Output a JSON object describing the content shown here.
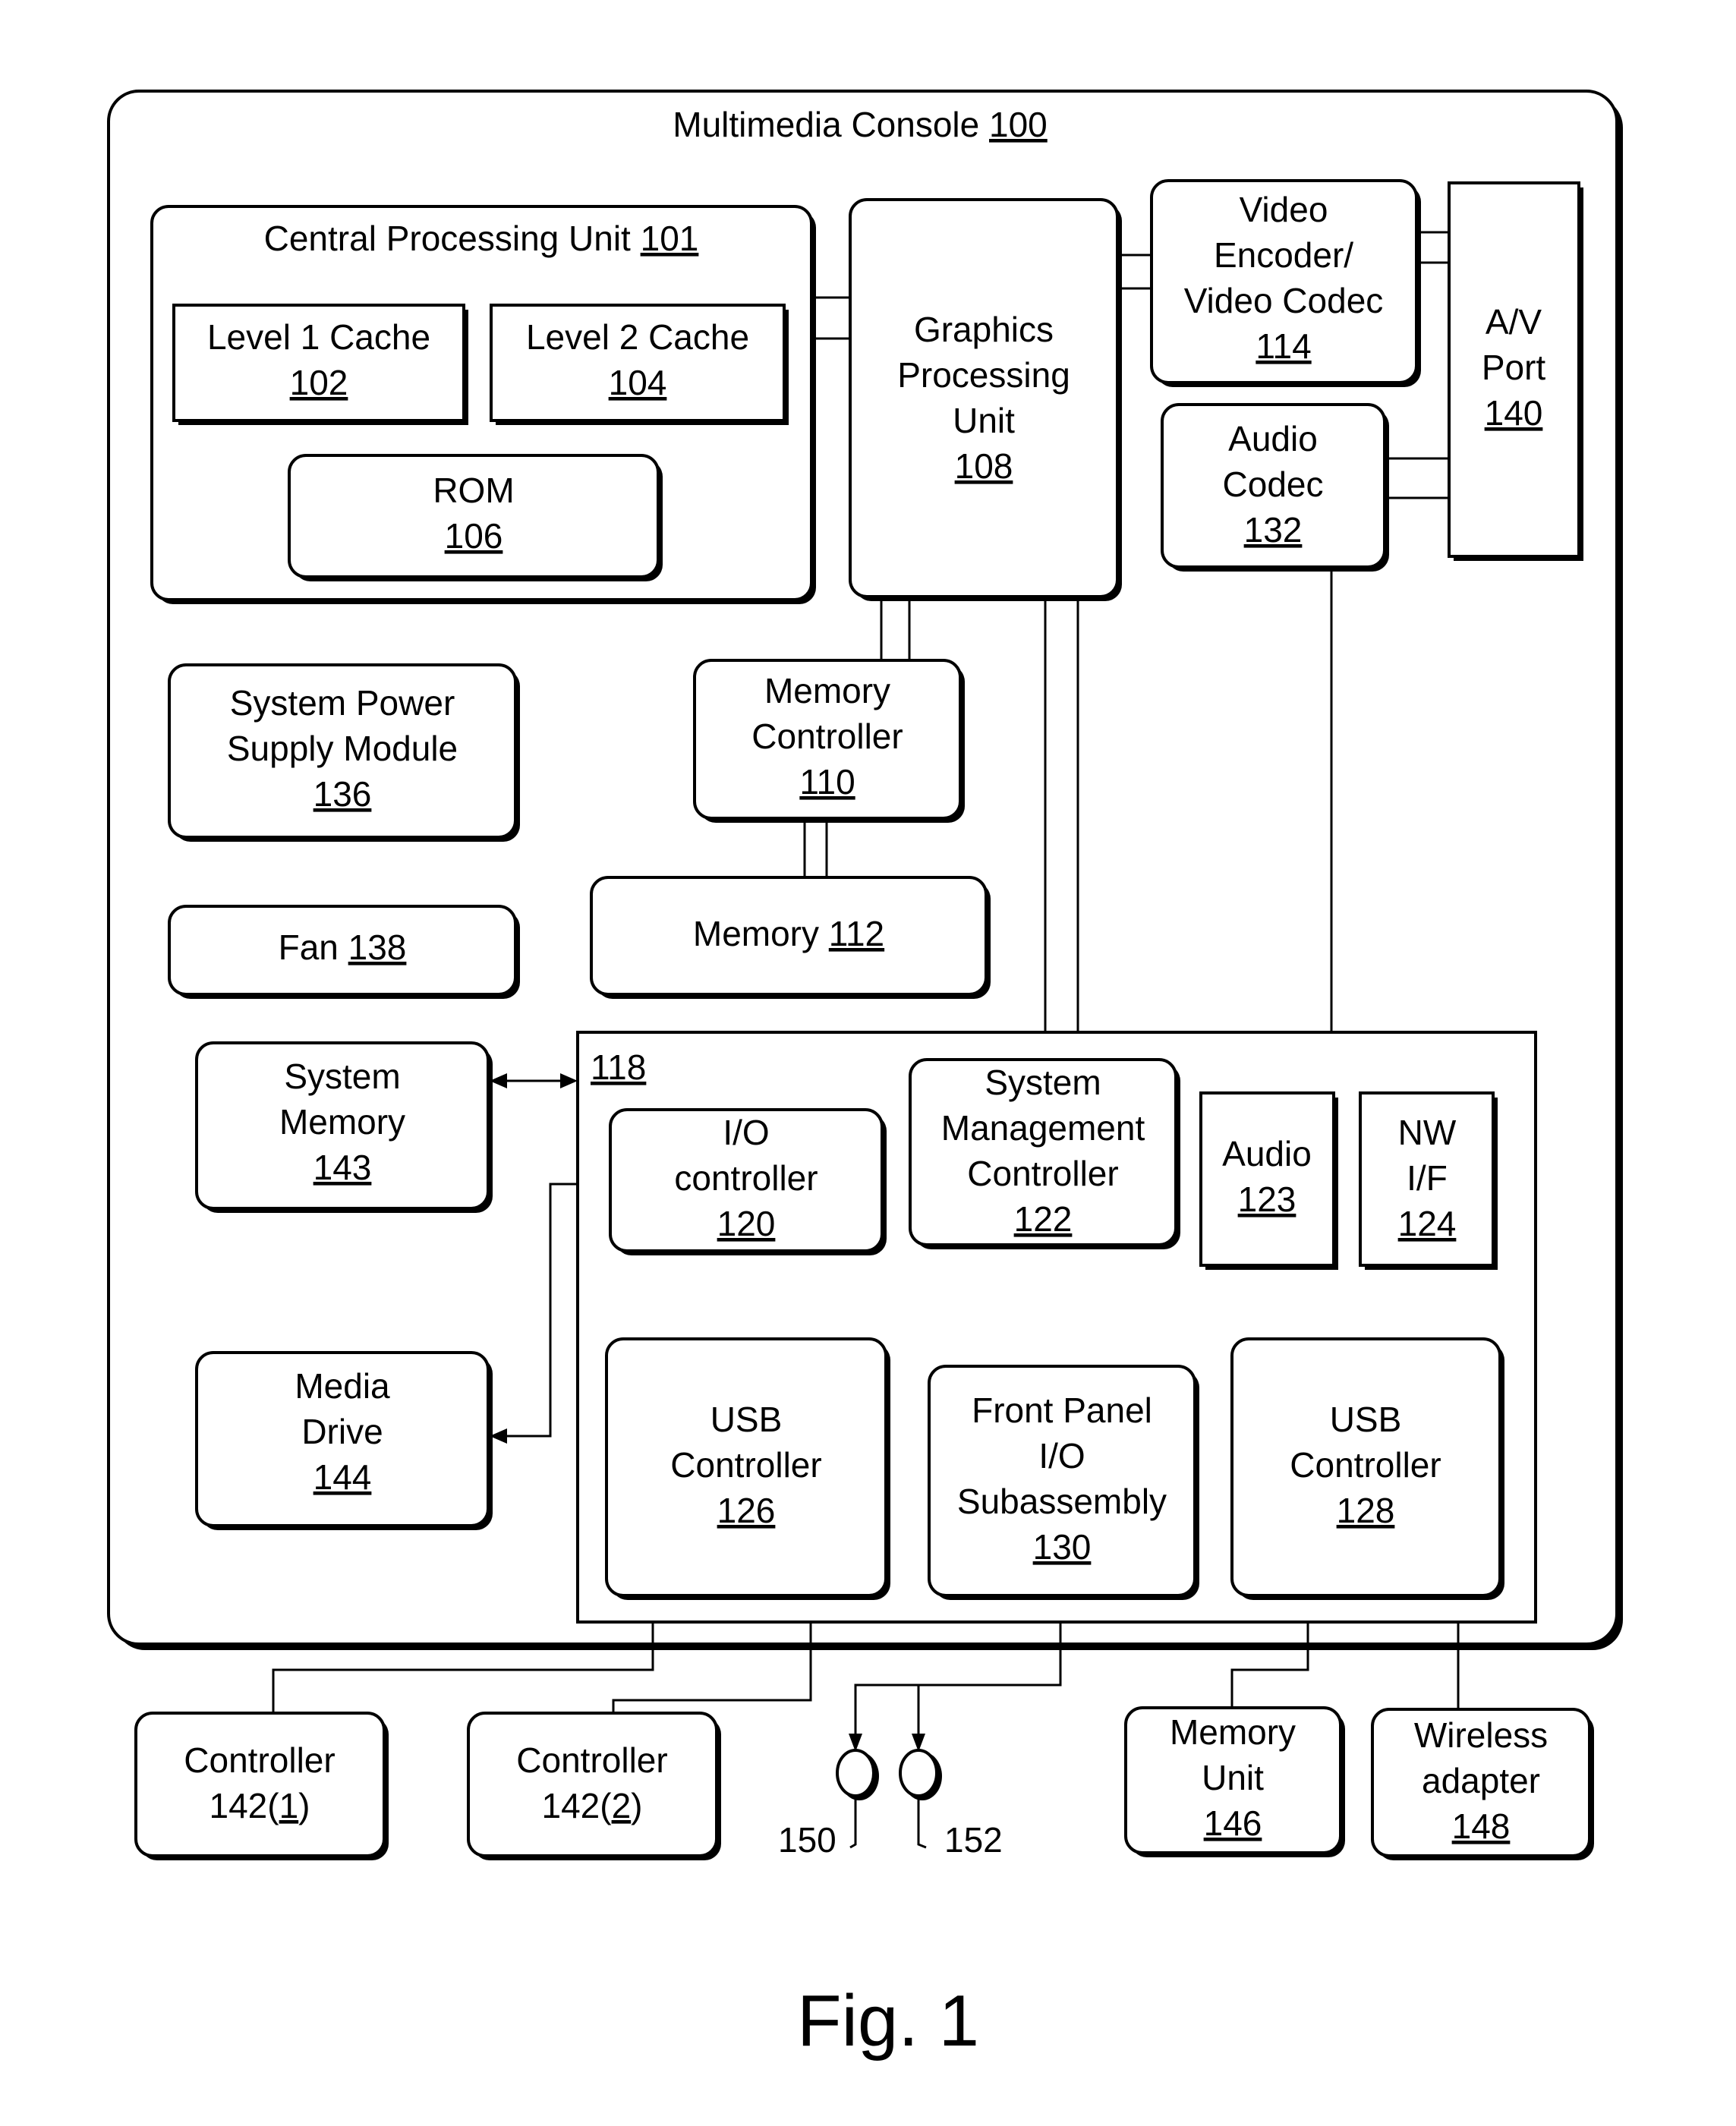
{
  "title": {
    "label": "Multimedia Console",
    "ref": "100"
  },
  "figure_caption": "Fig. 1",
  "blocks": {
    "cpu": {
      "lines": [
        "Central Processing Unit"
      ],
      "ref": "101"
    },
    "l1_cache": {
      "lines": [
        "Level 1 Cache"
      ],
      "ref": "102"
    },
    "l2_cache": {
      "lines": [
        "Level 2 Cache"
      ],
      "ref": "104"
    },
    "rom": {
      "lines": [
        "ROM"
      ],
      "ref": "106"
    },
    "gpu": {
      "lines": [
        "Graphics",
        "Processing",
        "Unit"
      ],
      "ref": "108"
    },
    "video_encoder": {
      "lines": [
        "Video",
        "Encoder/",
        "Video Codec"
      ],
      "ref": "114"
    },
    "av_port": {
      "lines": [
        "A/V",
        "Port"
      ],
      "ref": "140"
    },
    "audio_codec": {
      "lines": [
        "Audio",
        "Codec"
      ],
      "ref": "132"
    },
    "system_power": {
      "lines": [
        "System Power",
        "Supply Module"
      ],
      "ref": "136"
    },
    "memory_controller": {
      "lines": [
        "Memory",
        "Controller"
      ],
      "ref": "110"
    },
    "fan": {
      "lines": [
        "Fan"
      ],
      "ref": "138"
    },
    "memory": {
      "lines": [
        "Memory"
      ],
      "ref": "112"
    },
    "subsystem": {
      "ref": "118"
    },
    "system_memory": {
      "lines": [
        "System",
        "Memory"
      ],
      "ref": "143"
    },
    "io_controller": {
      "lines": [
        "I/O",
        "controller"
      ],
      "ref": "120"
    },
    "system_mgmt": {
      "lines": [
        "System",
        "Management",
        "Controller"
      ],
      "ref": "122"
    },
    "audio": {
      "lines": [
        "Audio"
      ],
      "ref": "123"
    },
    "nw_if": {
      "lines": [
        "NW",
        "I/F"
      ],
      "ref": "124"
    },
    "media_drive": {
      "lines": [
        "Media",
        "Drive"
      ],
      "ref": "144"
    },
    "usb_126": {
      "lines": [
        "USB",
        "Controller"
      ],
      "ref": "126"
    },
    "front_panel": {
      "lines": [
        "Front Panel",
        "I/O",
        "Subassembly"
      ],
      "ref": "130"
    },
    "usb_128": {
      "lines": [
        "USB",
        "Controller"
      ],
      "ref": "128"
    },
    "controller_1": {
      "lines": [
        "Controller"
      ],
      "prefix": "142(",
      "ref": "1",
      "suffix": ")"
    },
    "controller_2": {
      "lines": [
        "Controller"
      ],
      "prefix": "142(",
      "ref": "2",
      "suffix": ")"
    },
    "memory_unit": {
      "lines": [
        "Memory",
        "Unit"
      ],
      "ref": "146"
    },
    "wireless_adapter": {
      "lines": [
        "Wireless",
        "adapter"
      ],
      "ref": "148"
    }
  },
  "indicators": [
    {
      "ref": "150"
    },
    {
      "ref": "152"
    }
  ]
}
